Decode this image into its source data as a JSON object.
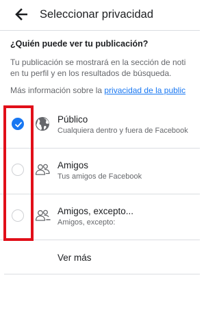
{
  "header": {
    "title": "Seleccionar privacidad",
    "back_icon": "arrow-left-icon"
  },
  "question": "¿Quién puede ver tu publicación?",
  "description": {
    "line1": "Tu publicación se mostrará en la sección de noti",
    "line2": "en tu perfil y en los resultados de búsqueda."
  },
  "more_info": {
    "prefix": "Más información sobre la ",
    "link": "privacidad de la public"
  },
  "options": [
    {
      "title": "Público",
      "subtitle": "Cualquiera dentro y fuera de Facebook",
      "icon": "globe-icon",
      "selected": true
    },
    {
      "title": "Amigos",
      "subtitle": "Tus amigos de Facebook",
      "icon": "friends-icon",
      "selected": false
    },
    {
      "title": "Amigos, excepto...",
      "subtitle": "Amigos, excepto:",
      "icon": "friends-except-icon",
      "selected": false
    }
  ],
  "see_more": "Ver más",
  "colors": {
    "accent": "#1877f2",
    "highlight": "#e10f19",
    "secondary_text": "#65676b",
    "divider": "#dadde1"
  }
}
